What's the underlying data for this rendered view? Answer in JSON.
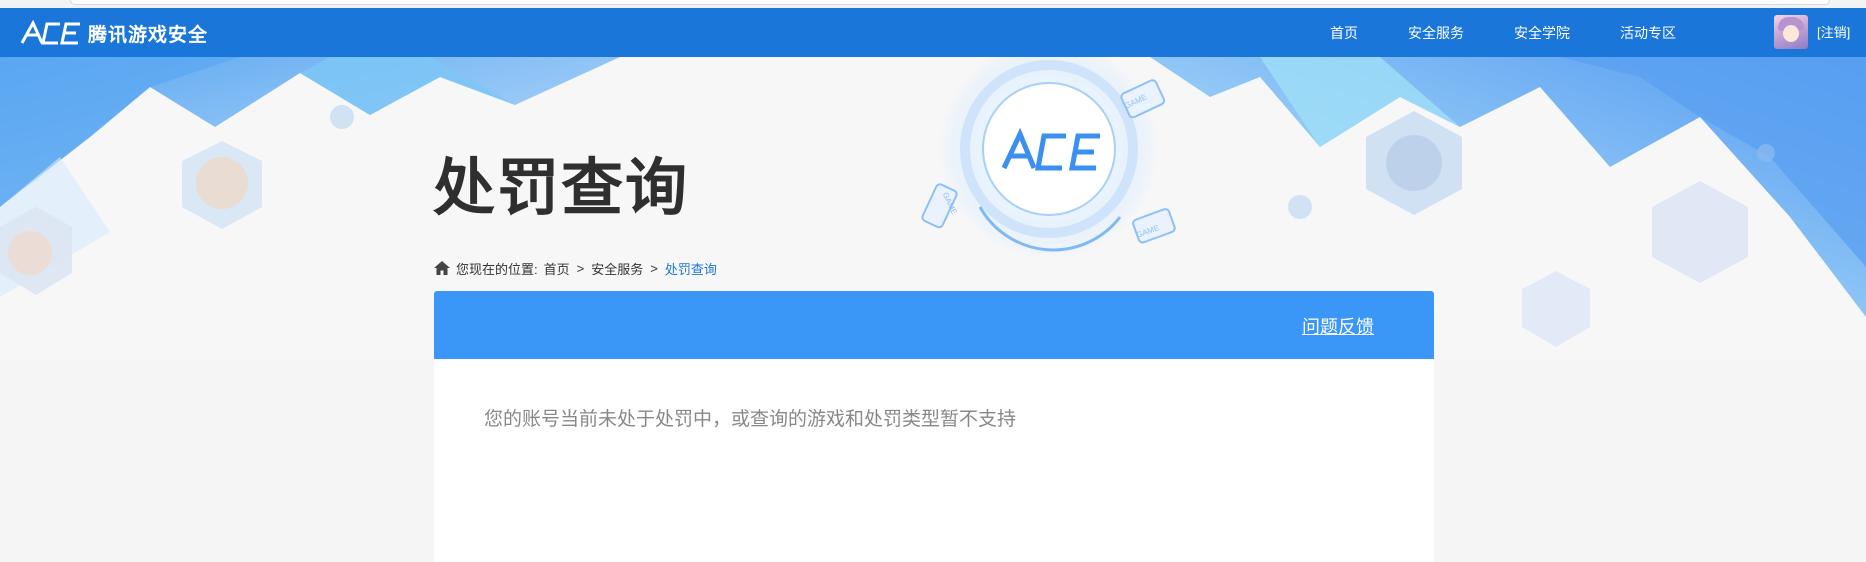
{
  "header": {
    "logo_text": "腾讯游戏安全",
    "nav": [
      "首页",
      "安全服务",
      "安全学院",
      "活动专区"
    ],
    "logout_label": "[注销]"
  },
  "banner": {
    "title": "处罚查询",
    "emblem_text": "ACE",
    "card_label": "GAME"
  },
  "breadcrumb": {
    "prefix": "您现在的位置:",
    "items": [
      "首页",
      "安全服务"
    ],
    "current": "处罚查询",
    "separator": ">"
  },
  "panel": {
    "feedback_label": "问题反馈",
    "message": "您的账号当前未处于处罚中，或查询的游戏和处罚类型暂不支持"
  },
  "colors": {
    "nav_bg": "#1a76d8",
    "panel_head": "#3a97f8",
    "accent_link": "#1a76d8"
  }
}
